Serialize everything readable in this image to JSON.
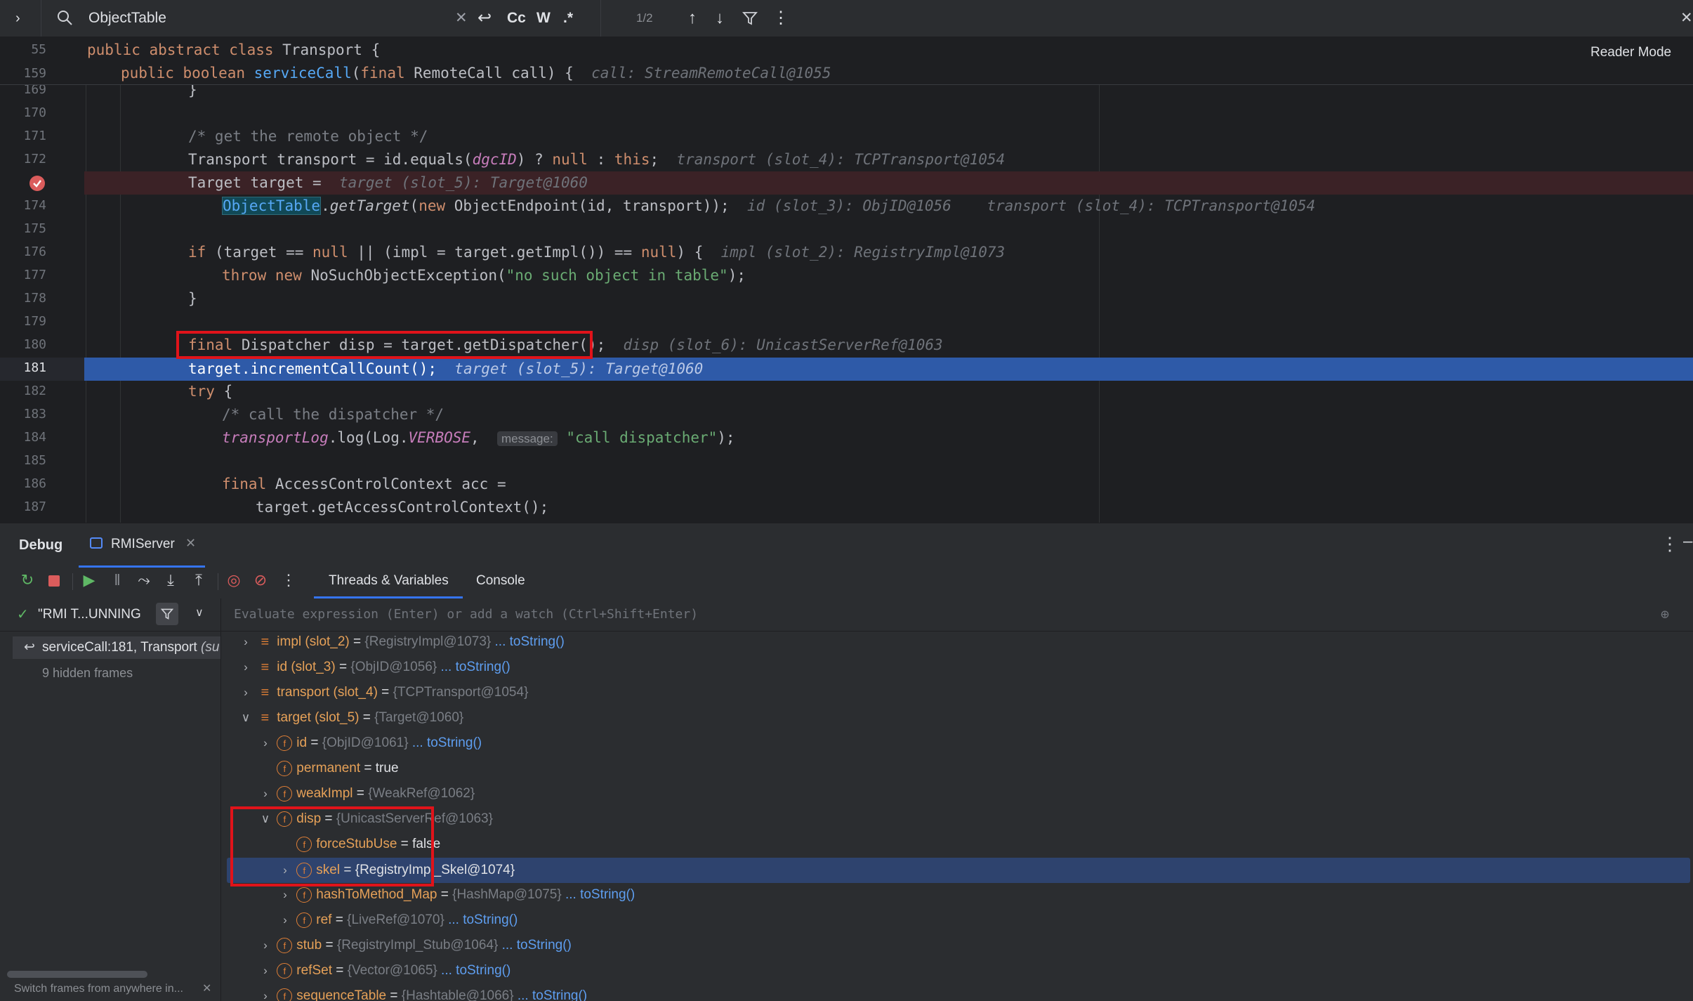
{
  "search": {
    "query": "ObjectTable",
    "match_count": "1/2",
    "cc_label": "Cc",
    "w_label": "W",
    "regex_label": ".*"
  },
  "editor": {
    "reader_mode": "Reader Mode",
    "sticky": [
      {
        "num": "55",
        "text_kw": "public abstract class",
        "text_rest": " Transport {"
      },
      {
        "num": "159"
      }
    ],
    "lines": {
      "l169": "169",
      "l170": "170",
      "l171": "171",
      "l172": "172",
      "l173": "",
      "l174": "174",
      "l175": "175",
      "l176": "176",
      "l177": "177",
      "l178": "178",
      "l179": "179",
      "l180": "180",
      "l181": "181",
      "l182": "182",
      "l183": "183",
      "l184": "184",
      "l185": "185",
      "l186": "186",
      "l187": "187"
    },
    "code": {
      "s159_a": "public boolean ",
      "s159_fn": "serviceCall",
      "s159_b": "(",
      "s159_kw": "final",
      "s159_c": " RemoteCall call) {  ",
      "s159_hint": "call: StreamRemoteCall@1055",
      "c169": "}",
      "c171": "/* get the remote object */",
      "c172_a": "Transport transport = id.equals(",
      "c172_it": "dgcID",
      "c172_b": ") ? ",
      "c172_kw1": "null",
      "c172_c": " : ",
      "c172_kw2": "this",
      "c172_d": ";  ",
      "c172_hint": "transport (slot_4): TCPTransport@1054",
      "c173_a": "Target target =  ",
      "c173_hint": "target (slot_5): Target@1060",
      "c174_obj": "ObjectTable",
      "c174_dot": ".",
      "c174_it": "getTarget",
      "c174_b": "(",
      "c174_kw": "new",
      "c174_c": " ObjectEndpoint(id, transport));  ",
      "c174_hint1": "id (slot_3): ObjID@1056",
      "c174_hint2": "transport (slot_4): TCPTransport@1054",
      "c176_kw1": "if",
      "c176_a": " (target == ",
      "c176_kw2": "null",
      "c176_b": " || (impl = target.getImpl()) == ",
      "c176_kw3": "null",
      "c176_c": ") {  ",
      "c176_hint": "impl (slot_2): RegistryImpl@1073",
      "c177_kw1": "throw",
      "c177_sp": " ",
      "c177_kw2": "new",
      "c177_a": " NoSuchObjectException(",
      "c177_str": "\"no such object in table\"",
      "c177_b": ");",
      "c178": "}",
      "c180_kw": "final",
      "c180_a": " Dispatcher disp = target.getDispatcher();",
      "c180_hint": "disp (slot_6): UnicastServerRef@1063",
      "c181_a": "target.incrementCallCount();  ",
      "c181_hint": "target (slot_5): Target@1060",
      "c182_kw": "try",
      "c182_a": " {",
      "c183": "/* call the dispatcher */",
      "c184_fld": "transportLog",
      "c184_a": ".log(Log.",
      "c184_fld2": "VERBOSE",
      "c184_b": ",  ",
      "c184_msg": "message:",
      "c184_str": "\"call dispatcher\"",
      "c184_c": ");",
      "c186_kw": "final",
      "c186_a": " AccessControlContext acc =",
      "c187": "target.getAccessControlContext();"
    }
  },
  "debug": {
    "title": "Debug",
    "session_tab": "RMIServer",
    "tabs": [
      "Threads & Variables",
      "Console"
    ],
    "thread": "\"RMI T...UNNING",
    "frame": "serviceCall:181, Transport",
    "frame_suffix": "(su",
    "hidden_frames": "9 hidden frames",
    "switch_hint": "Switch frames from anywhere in...",
    "eval_placeholder": "Evaluate expression (Enter) or add a watch (Ctrl+Shift+Enter)",
    "vars": [
      {
        "name": "impl (slot_2)",
        "value": "{RegistryImpl@1073}",
        "tostr": "... toString()"
      },
      {
        "name": "id (slot_3)",
        "value": "{ObjID@1056}",
        "tostr": "... toString()"
      },
      {
        "name": "transport (slot_4)",
        "value": "{TCPTransport@1054}",
        "tostr": ""
      },
      {
        "name": "target (slot_5)",
        "value": "{Target@1060}",
        "tostr": ""
      },
      {
        "name": "id",
        "value": "{ObjID@1061}",
        "tostr": "... toString()"
      },
      {
        "name": "permanent",
        "value": "true",
        "tostr": ""
      },
      {
        "name": "weakImpl",
        "value": "{WeakRef@1062}",
        "tostr": ""
      },
      {
        "name": "disp",
        "value": "{UnicastServerRef@1063}",
        "tostr": ""
      },
      {
        "name": "forceStubUse",
        "value": "false",
        "tostr": ""
      },
      {
        "name": "skel",
        "value": "{RegistryImpl_Skel@1074}",
        "tostr": ""
      },
      {
        "name": "hashToMethod_Map",
        "value": "{HashMap@1075}",
        "tostr": "... toString()"
      },
      {
        "name": "ref",
        "value": "{LiveRef@1070}",
        "tostr": "... toString()"
      },
      {
        "name": "stub",
        "value": "{RegistryImpl_Stub@1064}",
        "tostr": "... toString()"
      },
      {
        "name": "refSet",
        "value": "{Vector@1065}",
        "tostr": "... toString()"
      },
      {
        "name": "sequenceTable",
        "value": "{Hashtable@1066}",
        "tostr": "... toString()"
      }
    ]
  },
  "colors": {
    "accent": "#2e5aa8",
    "highlight_box": "#e0131a",
    "breakpoint_line": "#3b2226"
  }
}
